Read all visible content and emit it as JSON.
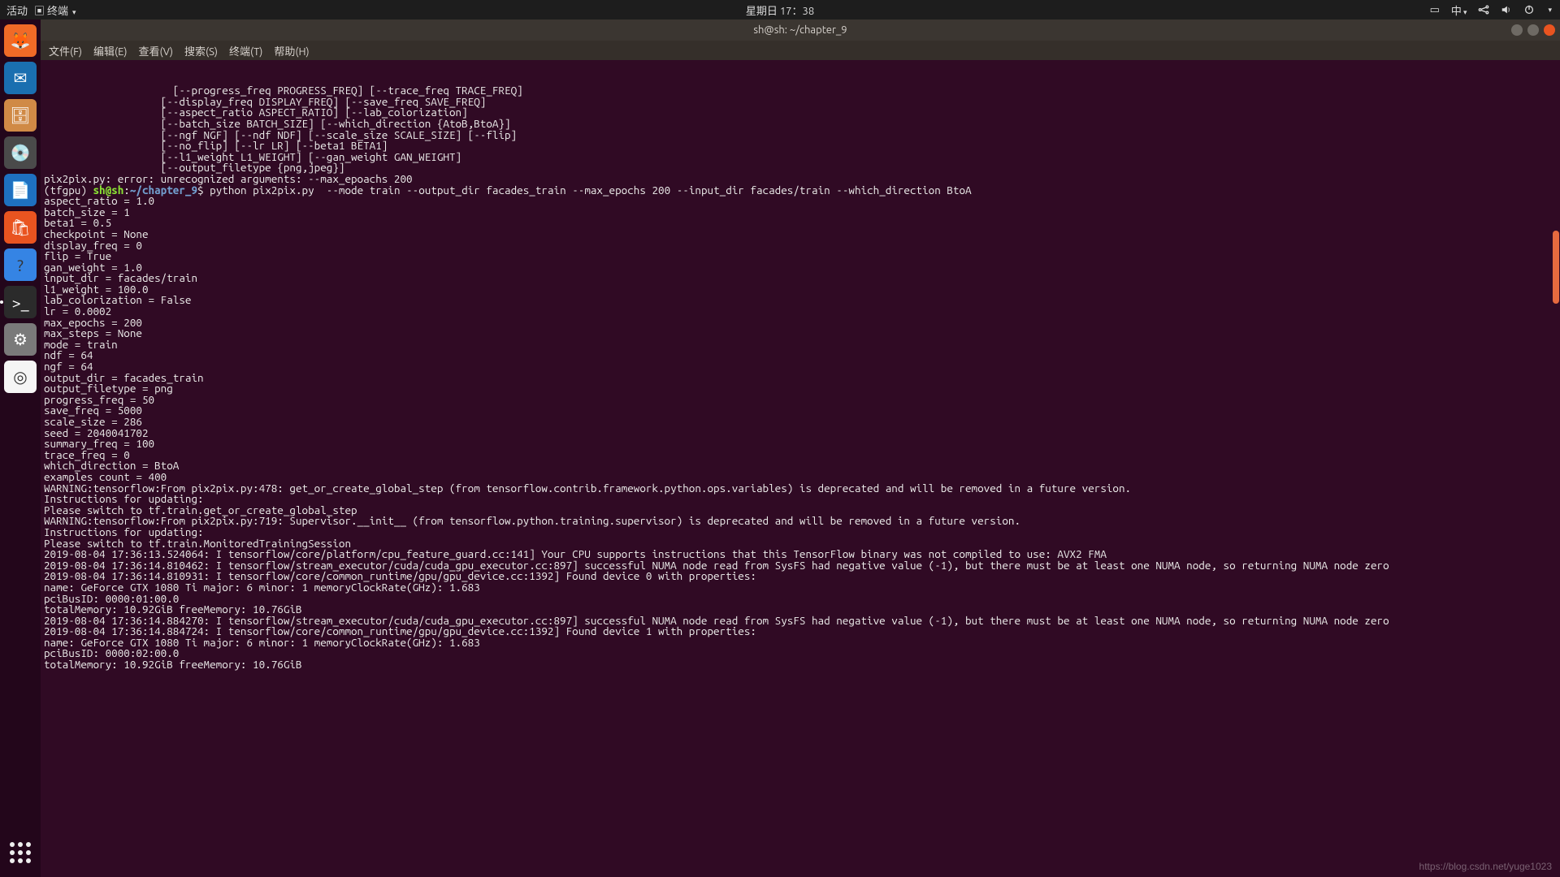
{
  "panel": {
    "activities": "活动",
    "app_indicator_icon": "▣",
    "app_indicator_label": "终端",
    "clock": "星期日 17：38",
    "ime_label": "中",
    "battery_icon": "▭"
  },
  "dock": {
    "items": [
      {
        "name": "firefox",
        "bg": "#f06a27",
        "glyph": "🦊"
      },
      {
        "name": "thunderbird",
        "bg": "#1a6fb0",
        "glyph": "✉"
      },
      {
        "name": "files",
        "bg": "#d08a46",
        "glyph": "🗄"
      },
      {
        "name": "disks",
        "bg": "#4a4a4a",
        "glyph": "💿"
      },
      {
        "name": "writer",
        "bg": "#1e70c0",
        "glyph": "📄"
      },
      {
        "name": "software",
        "bg": "#e95420",
        "glyph": "🛍"
      },
      {
        "name": "help",
        "bg": "#3584e4",
        "glyph": "?"
      },
      {
        "name": "terminal",
        "bg": "#2b2b2b",
        "glyph": ">_",
        "active": true
      },
      {
        "name": "tweaks",
        "bg": "#7a7a7a",
        "glyph": "⚙"
      },
      {
        "name": "screenshot",
        "bg": "#f5f5f5",
        "glyph": "◎"
      }
    ]
  },
  "window": {
    "title": "sh@sh: ~/chapter_9",
    "menus": [
      "文件(F)",
      "编辑(E)",
      "查看(V)",
      "搜索(S)",
      "终端(T)",
      "帮助(H)"
    ]
  },
  "prompt": {
    "env_prefix": "(tfgpu) ",
    "userhost": "sh@sh",
    "colon": ":",
    "cwd": "~/chapter_9",
    "dollar": "$ ",
    "command": "python pix2pix.py  --mode train --output_dir facades_train --max_epochs 200 --input_dir facades/train --which_direction BtoA"
  },
  "usage_lines": [
    "                   [--progress_freq PROGRESS_FREQ] [--trace_freq TRACE_FREQ]",
    "                   [--display_freq DISPLAY_FREQ] [--save_freq SAVE_FREQ]",
    "                   [--aspect_ratio ASPECT_RATIO] [--lab_colorization]",
    "                   [--batch_size BATCH_SIZE] [--which_direction {AtoB,BtoA}]",
    "                   [--ngf NGF] [--ndf NDF] [--scale_size SCALE_SIZE] [--flip]",
    "                   [--no_flip] [--lr LR] [--beta1 BETA1]",
    "                   [--l1_weight L1_WEIGHT] [--gan_weight GAN_WEIGHT]",
    "                   [--output_filetype {png,jpeg}]",
    "pix2pix.py: error: unrecognized arguments: --max_epoachs 200"
  ],
  "param_lines": [
    "aspect_ratio = 1.0",
    "batch_size = 1",
    "beta1 = 0.5",
    "checkpoint = None",
    "display_freq = 0",
    "flip = True",
    "gan_weight = 1.0",
    "input_dir = facades/train",
    "l1_weight = 100.0",
    "lab_colorization = False",
    "lr = 0.0002",
    "max_epochs = 200",
    "max_steps = None",
    "mode = train",
    "ndf = 64",
    "ngf = 64",
    "output_dir = facades_train",
    "output_filetype = png",
    "progress_freq = 50",
    "save_freq = 5000",
    "scale_size = 286",
    "seed = 2040041702",
    "summary_freq = 100",
    "trace_freq = 0",
    "which_direction = BtoA",
    "examples count = 400"
  ],
  "log_lines": [
    "WARNING:tensorflow:From pix2pix.py:478: get_or_create_global_step (from tensorflow.contrib.framework.python.ops.variables) is deprecated and will be removed in a future version.",
    "Instructions for updating:",
    "Please switch to tf.train.get_or_create_global_step",
    "WARNING:tensorflow:From pix2pix.py:719: Supervisor.__init__ (from tensorflow.python.training.supervisor) is deprecated and will be removed in a future version.",
    "Instructions for updating:",
    "Please switch to tf.train.MonitoredTrainingSession",
    "2019-08-04 17:36:13.524064: I tensorflow/core/platform/cpu_feature_guard.cc:141] Your CPU supports instructions that this TensorFlow binary was not compiled to use: AVX2 FMA",
    "2019-08-04 17:36:14.810462: I tensorflow/stream_executor/cuda/cuda_gpu_executor.cc:897] successful NUMA node read from SysFS had negative value (-1), but there must be at least one NUMA node, so returning NUMA node zero",
    "2019-08-04 17:36:14.810931: I tensorflow/core/common_runtime/gpu/gpu_device.cc:1392] Found device 0 with properties:",
    "name: GeForce GTX 1080 Ti major: 6 minor: 1 memoryClockRate(GHz): 1.683",
    "pciBusID: 0000:01:00.0",
    "totalMemory: 10.92GiB freeMemory: 10.76GiB",
    "2019-08-04 17:36:14.884270: I tensorflow/stream_executor/cuda/cuda_gpu_executor.cc:897] successful NUMA node read from SysFS had negative value (-1), but there must be at least one NUMA node, so returning NUMA node zero",
    "2019-08-04 17:36:14.884724: I tensorflow/core/common_runtime/gpu/gpu_device.cc:1392] Found device 1 with properties:",
    "name: GeForce GTX 1080 Ti major: 6 minor: 1 memoryClockRate(GHz): 1.683",
    "pciBusID: 0000:02:00.0",
    "totalMemory: 10.92GiB freeMemory: 10.76GiB"
  ],
  "watermark": "https://blog.csdn.net/yuge1023"
}
